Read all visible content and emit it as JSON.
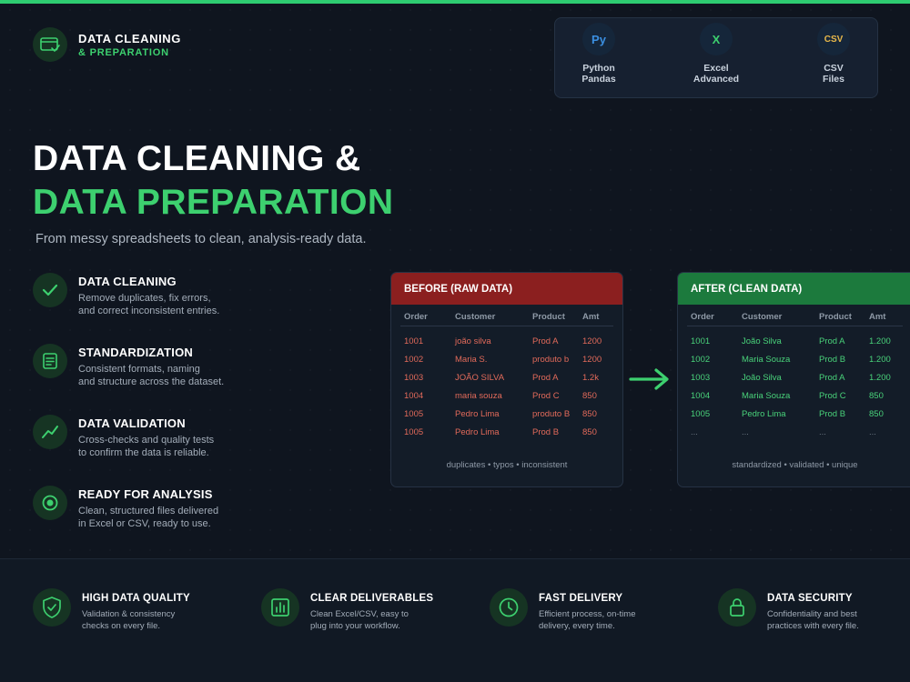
{
  "colors": {
    "accent": "#3dd06f",
    "before_header": "#8b1f1f",
    "after_header": "#1c7a3d",
    "background": "#0f151f"
  },
  "logo": {
    "line1": "DATA CLEANING",
    "line2": "& PREPARATION",
    "icon": "envelope-check-icon"
  },
  "tools": [
    {
      "icon_text": "Py",
      "label1": "Python",
      "label2": "Pandas",
      "icon_color": "#3b8fe0"
    },
    {
      "icon_text": "X",
      "label1": "Excel",
      "label2": "Advanced",
      "icon_color": "#3dd06f"
    },
    {
      "icon_text": "CSV",
      "label1": "CSV",
      "label2": "Files",
      "icon_color": "#e8b84a"
    }
  ],
  "hero": {
    "line1": "DATA CLEANING &",
    "line2": "DATA PREPARATION",
    "subtitle": "From messy spreadsheets to clean, analysis-ready data."
  },
  "features": [
    {
      "icon": "check-icon",
      "title": "DATA CLEANING",
      "desc1": "Remove duplicates, fix errors,",
      "desc2": "and correct inconsistent entries."
    },
    {
      "icon": "document-list-icon",
      "title": "STANDARDIZATION",
      "desc1": "Consistent formats, naming",
      "desc2": "and structure across the dataset."
    },
    {
      "icon": "trend-line-icon",
      "title": "DATA VALIDATION",
      "desc1": "Cross-checks and quality tests",
      "desc2": "to confirm the data is reliable."
    },
    {
      "icon": "target-icon",
      "title": "READY FOR ANALYSIS",
      "desc1": "Clean, structured files delivered",
      "desc2": "in Excel or CSV, ready to use."
    }
  ],
  "before_table": {
    "title": "BEFORE (RAW DATA)",
    "columns": [
      "Order",
      "Customer",
      "Product",
      "Amt"
    ],
    "rows": [
      [
        "1001",
        "joão silva",
        "Prod A",
        "1200"
      ],
      [
        "1002",
        "Maria S.",
        "produto b",
        "1200"
      ],
      [
        "1003",
        "JOÃO SILVA",
        "Prod A",
        "1.2k"
      ],
      [
        "1004",
        "maria souza",
        "Prod C",
        "850"
      ],
      [
        "1005",
        "Pedro Lima",
        "produto B",
        "850"
      ],
      [
        "1005",
        "Pedro Lima",
        "Prod B",
        "850"
      ]
    ],
    "footer": "duplicates • typos • inconsistent"
  },
  "after_table": {
    "title": "AFTER (CLEAN DATA)",
    "columns": [
      "Order",
      "Customer",
      "Product",
      "Amt"
    ],
    "rows": [
      [
        "1001",
        "João Silva",
        "Prod A",
        "1.200"
      ],
      [
        "1002",
        "Maria Souza",
        "Prod B",
        "1.200"
      ],
      [
        "1003",
        "João Silva",
        "Prod A",
        "1.200"
      ],
      [
        "1004",
        "Maria Souza",
        "Prod C",
        "850"
      ],
      [
        "1005",
        "Pedro Lima",
        "Prod B",
        "850"
      ],
      [
        "...",
        "...",
        "...",
        "..."
      ]
    ],
    "footer": "standardized • validated • unique"
  },
  "bottom": [
    {
      "icon": "shield-check-icon",
      "title": "HIGH DATA QUALITY",
      "desc1": "Validation & consistency",
      "desc2": "checks on every file."
    },
    {
      "icon": "bar-chart-icon",
      "title": "CLEAR DELIVERABLES",
      "desc1": "Clean Excel/CSV, easy to",
      "desc2": "plug into your workflow."
    },
    {
      "icon": "clock-icon",
      "title": "FAST DELIVERY",
      "desc1": "Efficient process, on-time",
      "desc2": "delivery, every time."
    },
    {
      "icon": "lock-icon",
      "title": "DATA SECURITY",
      "desc1": "Confidentiality and best",
      "desc2": "practices with every file."
    }
  ]
}
